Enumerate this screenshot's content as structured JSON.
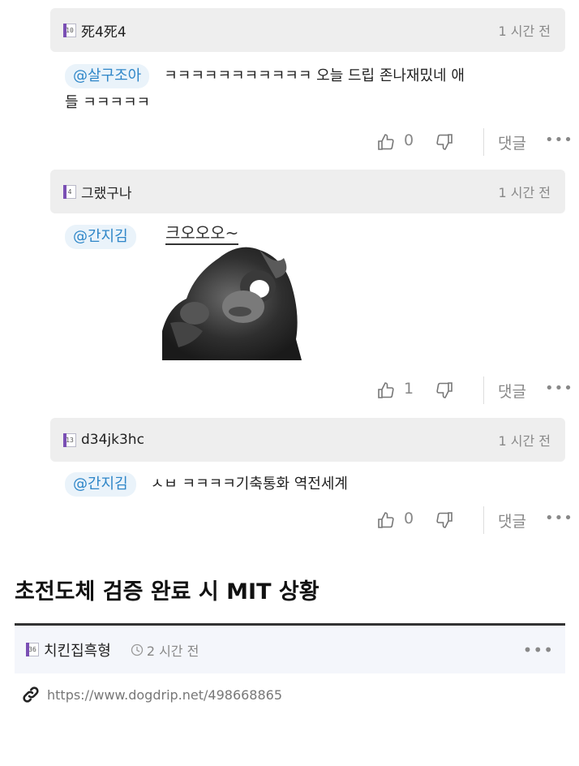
{
  "comments": [
    {
      "level": "10",
      "nickname": "死4死4",
      "time": "1 시간 전",
      "mention": "@살구조아",
      "text_line1": "ㅋㅋㅋㅋㅋㅋㅋㅋㅋㅋㅋ 오늘 드립 존나재밌네 애",
      "text_line2": "들 ㅋㅋㅋㅋㅋ",
      "likes": "0",
      "reply_label": "댓글",
      "more": "•••"
    },
    {
      "level": "4",
      "nickname": "그랬구나",
      "time": "1 시간 전",
      "mention": "@간지김",
      "emoticon": "크오오오~",
      "likes": "1",
      "reply_label": "댓글",
      "more": "•••"
    },
    {
      "level": "13",
      "nickname": "d34jk3hc",
      "time": "1 시간 전",
      "mention": "@간지김",
      "text_line1": "ㅅㅂ ㅋㅋㅋㅋ기축통화 역전세계",
      "likes": "0",
      "reply_label": "댓글",
      "more": "•••"
    }
  ],
  "post": {
    "title": "초전도체 검증 완료 시 MIT 상황",
    "author_level": "36",
    "author": "치킨집흑형",
    "time": "2 시간 전",
    "more": "•••",
    "url": "https://www.dogdrip.net/498668865"
  },
  "icons": {
    "like": "thumbs-up-icon",
    "dislike": "thumbs-down-icon",
    "time": "clock-icon",
    "link": "link-icon"
  },
  "colors": {
    "mention_bg": "#eaf3fa",
    "mention_text": "#2e86c8",
    "header_bg": "#eeeeee",
    "level_badge": "#7a4fb4"
  }
}
